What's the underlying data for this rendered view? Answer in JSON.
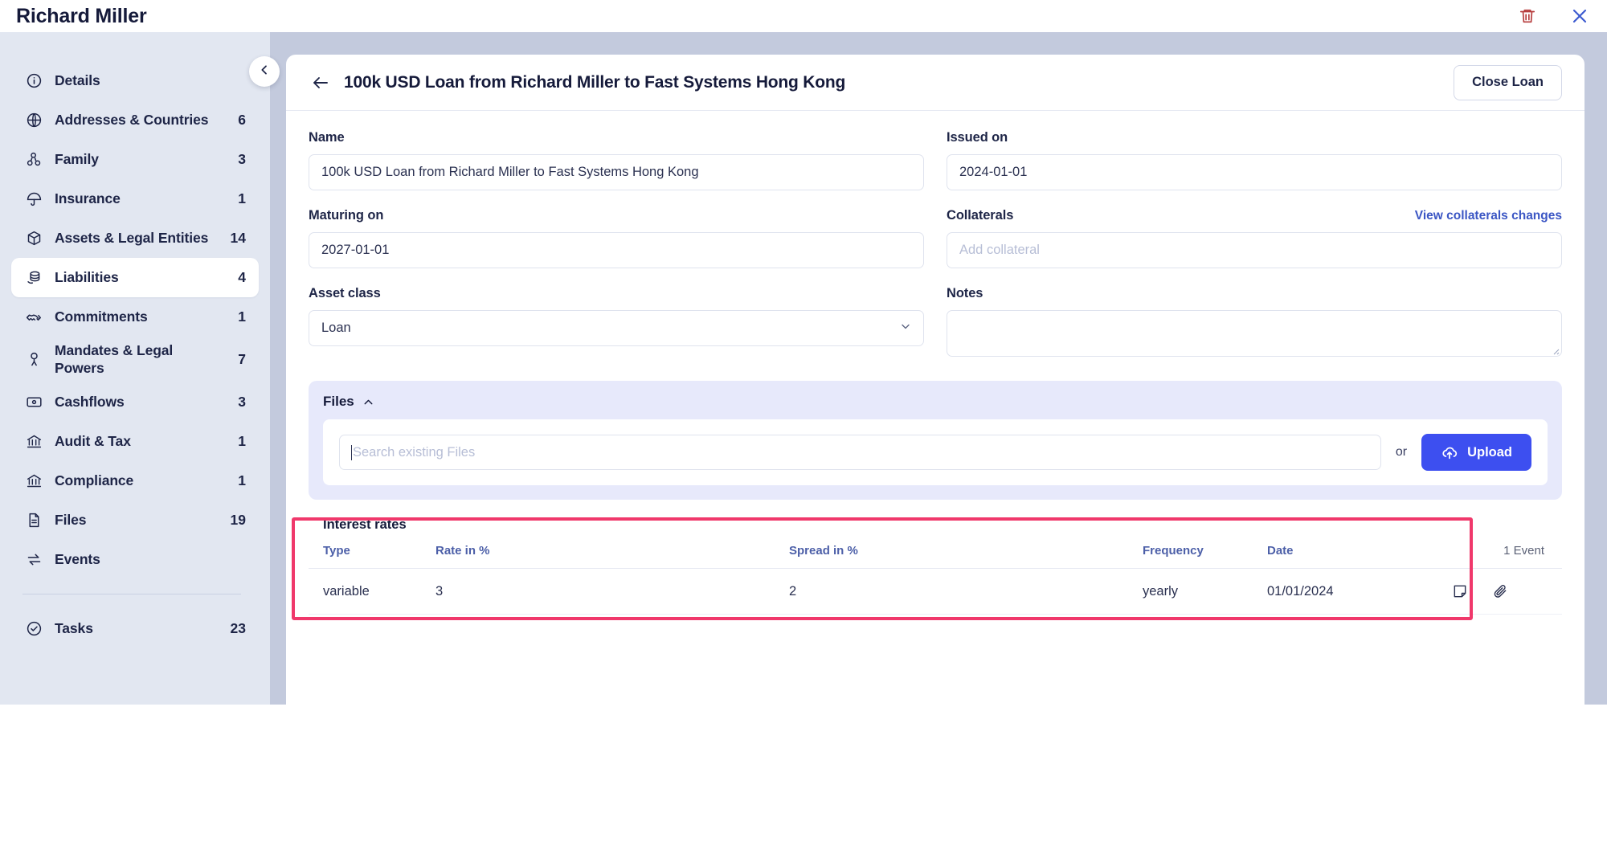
{
  "topbar": {
    "title": "Richard Miller",
    "delete_icon": "trash-icon",
    "close_icon": "close-icon",
    "delete_color": "#b53a3a",
    "close_color": "#3d5bd0"
  },
  "sidebar": {
    "collapse_icon": "chevron-left-icon",
    "items": [
      {
        "label": "Details",
        "count": "",
        "icon": "info-icon",
        "active": false
      },
      {
        "label": "Addresses & Countries",
        "count": "6",
        "icon": "globe-icon",
        "active": false
      },
      {
        "label": "Family",
        "count": "3",
        "icon": "family-icon",
        "active": false
      },
      {
        "label": "Insurance",
        "count": "1",
        "icon": "umbrella-icon",
        "active": false
      },
      {
        "label": "Assets & Legal Entities",
        "count": "14",
        "icon": "box-icon",
        "active": false
      },
      {
        "label": "Liabilities",
        "count": "4",
        "icon": "coins-icon",
        "active": true
      },
      {
        "label": "Commitments",
        "count": "1",
        "icon": "handshake-icon",
        "active": false
      },
      {
        "label": "Mandates & Legal Powers",
        "count": "7",
        "icon": "person-seal-icon",
        "active": false
      },
      {
        "label": "Cashflows",
        "count": "3",
        "icon": "banknote-icon",
        "active": false
      },
      {
        "label": "Audit & Tax",
        "count": "1",
        "icon": "bank-icon",
        "active": false
      },
      {
        "label": "Compliance",
        "count": "1",
        "icon": "bank-icon",
        "active": false
      },
      {
        "label": "Files",
        "count": "19",
        "icon": "document-icon",
        "active": false
      },
      {
        "label": "Events",
        "count": "",
        "icon": "exchange-icon",
        "active": false
      }
    ],
    "footer_items": [
      {
        "label": "Tasks",
        "count": "23",
        "icon": "check-circle-icon"
      }
    ]
  },
  "detail": {
    "back_icon": "arrow-left-icon",
    "title": "100k USD Loan from Richard Miller to Fast Systems Hong Kong",
    "close_loan_label": "Close Loan",
    "fields": {
      "name_label": "Name",
      "name_value": "100k USD Loan from Richard Miller to Fast Systems Hong Kong",
      "issued_label": "Issued on",
      "issued_value": "2024-01-01",
      "maturing_label": "Maturing on",
      "maturing_value": "2027-01-01",
      "collaterals_label": "Collaterals",
      "collaterals_link": "View collaterals changes",
      "collaterals_placeholder": "Add collateral",
      "asset_class_label": "Asset class",
      "asset_class_value": "Loan",
      "asset_class_chevron": "chevron-down-icon",
      "notes_label": "Notes",
      "notes_value": ""
    }
  },
  "files": {
    "title": "Files",
    "collapse_icon": "chevron-up-icon",
    "search_placeholder": "Search existing Files",
    "or_label": "or",
    "upload_label": "Upload",
    "upload_icon": "cloud-upload-icon",
    "upload_color": "#3d4ff0"
  },
  "interest_rates": {
    "title": "Interest rates",
    "highlight_color": "#f0386b",
    "events_label": "1 Event",
    "columns": [
      "Type",
      "Rate in %",
      "Spread in %",
      "Frequency",
      "Date"
    ],
    "rows": [
      {
        "type": "variable",
        "rate": "3",
        "spread": "2",
        "frequency": "yearly",
        "date": "01/01/2024",
        "note_icon": "note-icon",
        "attachment_icon": "paperclip-icon"
      }
    ]
  }
}
